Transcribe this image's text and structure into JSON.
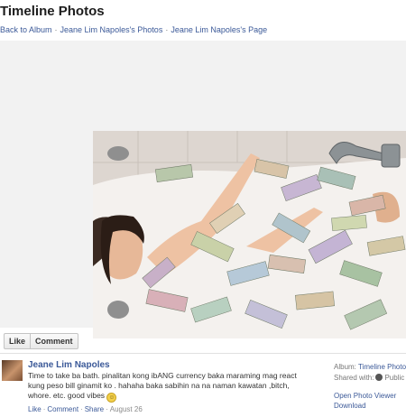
{
  "page": {
    "title": "Timeline Photos",
    "breadcrumbs": [
      "Back to Album",
      "Jeane Lim Napoles's Photos",
      "Jeane Lim Napoles's Page"
    ]
  },
  "actions": {
    "like": "Like",
    "comment": "Comment"
  },
  "post": {
    "author": "Jeane Lim Napoles",
    "caption": "Time to take ba bath. pinalitan kong ibANG currency baka maraming mag react kung peso bill ginamit ko . hahaha baka sabihin na na naman kawatan ,bitch, whore. etc. good vibes",
    "emoji": "smiley-emoji",
    "meta": {
      "like": "Like",
      "comment": "Comment",
      "share": "Share",
      "date": "August 26"
    }
  },
  "sidebar": {
    "album_label": "Album:",
    "album_value": "Timeline Photos",
    "shared_label": "Shared with:",
    "shared_value": "Public",
    "shared_icon": "globe-icon",
    "open_viewer": "Open Photo Viewer",
    "download": "Download"
  },
  "colors": {
    "link": "#3b5998",
    "stage": "#f2f2f2"
  }
}
